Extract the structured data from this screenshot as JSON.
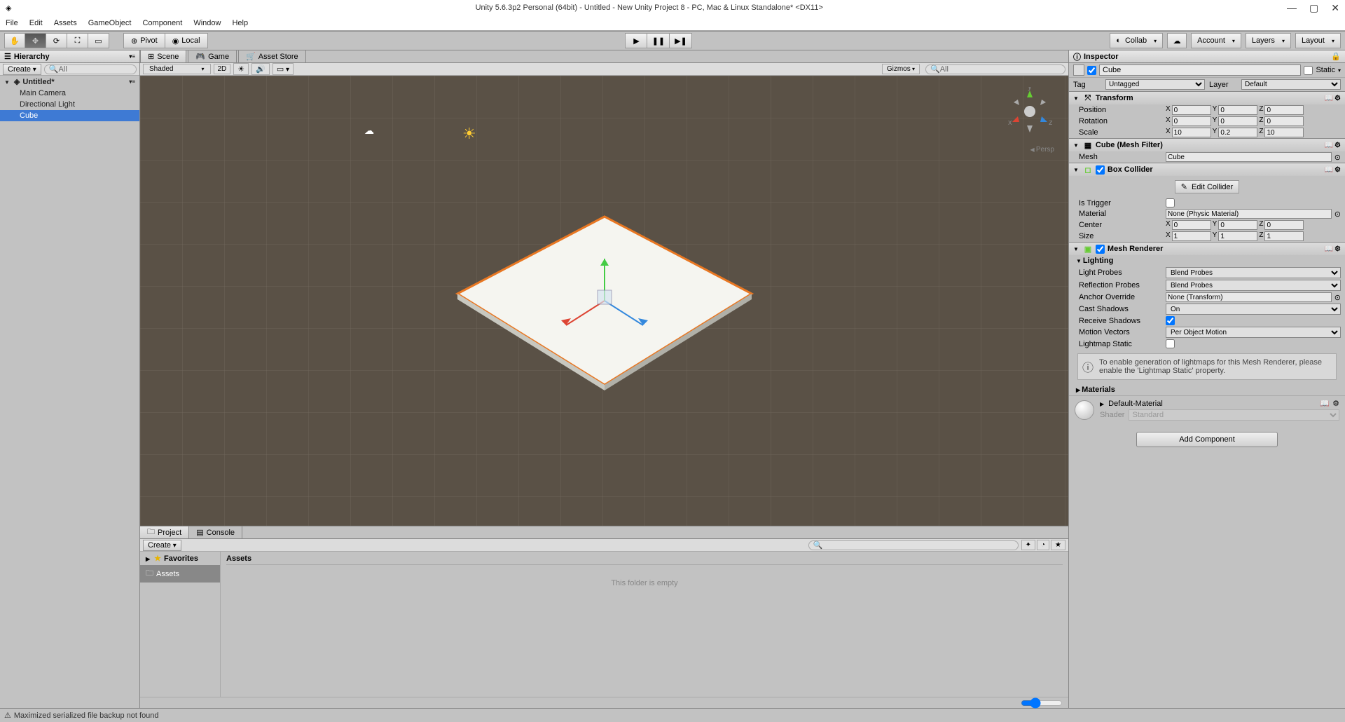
{
  "window": {
    "title": "Unity 5.6.3p2 Personal (64bit) - Untitled - New Unity Project 8 - PC, Mac & Linux Standalone* <DX11>"
  },
  "menu": [
    "File",
    "Edit",
    "Assets",
    "GameObject",
    "Component",
    "Window",
    "Help"
  ],
  "toolbar": {
    "pivot": "Pivot",
    "local": "Local",
    "collab": "Collab",
    "account": "Account",
    "layers": "Layers",
    "layout": "Layout"
  },
  "hierarchy": {
    "title": "Hierarchy",
    "create": "Create",
    "search_placeholder": "All",
    "scene": "Untitled*",
    "items": [
      "Main Camera",
      "Directional Light",
      "Cube"
    ],
    "selected": "Cube"
  },
  "scene_tabs": {
    "scene": "Scene",
    "game": "Game",
    "asset_store": "Asset Store"
  },
  "scene_toolbar": {
    "shaded": "Shaded",
    "mode2d": "2D",
    "gizmos": "Gizmos",
    "search_placeholder": "All",
    "persp": "Persp"
  },
  "project": {
    "tab_project": "Project",
    "tab_console": "Console",
    "create": "Create",
    "favorites": "Favorites",
    "assets": "Assets",
    "header": "Assets",
    "empty": "This folder is empty"
  },
  "inspector": {
    "title": "Inspector",
    "name": "Cube",
    "static": "Static",
    "tag_label": "Tag",
    "tag": "Untagged",
    "layer_label": "Layer",
    "layer": "Default",
    "transform": {
      "title": "Transform",
      "position": "Position",
      "rotation": "Rotation",
      "scale": "Scale",
      "pos": {
        "x": "0",
        "y": "0",
        "z": "0"
      },
      "rot": {
        "x": "0",
        "y": "0",
        "z": "0"
      },
      "scl": {
        "x": "10",
        "y": "0.2",
        "z": "10"
      }
    },
    "mesh_filter": {
      "title": "Cube (Mesh Filter)",
      "mesh_label": "Mesh",
      "mesh": "Cube"
    },
    "box_collider": {
      "title": "Box Collider",
      "edit": "Edit Collider",
      "is_trigger": "Is Trigger",
      "material_label": "Material",
      "material": "None (Physic Material)",
      "center_label": "Center",
      "size_label": "Size",
      "center": {
        "x": "0",
        "y": "0",
        "z": "0"
      },
      "size": {
        "x": "1",
        "y": "1",
        "z": "1"
      }
    },
    "mesh_renderer": {
      "title": "Mesh Renderer",
      "lighting": "Lighting",
      "light_probes_label": "Light Probes",
      "light_probes": "Blend Probes",
      "reflection_probes_label": "Reflection Probes",
      "reflection_probes": "Blend Probes",
      "anchor_label": "Anchor Override",
      "anchor": "None (Transform)",
      "cast_shadows_label": "Cast Shadows",
      "cast_shadows": "On",
      "receive_shadows_label": "Receive Shadows",
      "motion_vectors_label": "Motion Vectors",
      "motion_vectors": "Per Object Motion",
      "lightmap_static_label": "Lightmap Static",
      "info": "To enable generation of lightmaps for this Mesh Renderer, please enable the 'Lightmap Static' property.",
      "materials": "Materials"
    },
    "material": {
      "name": "Default-Material",
      "shader_label": "Shader",
      "shader": "Standard"
    },
    "add_component": "Add Component"
  },
  "status": "Maximized serialized file backup not found"
}
